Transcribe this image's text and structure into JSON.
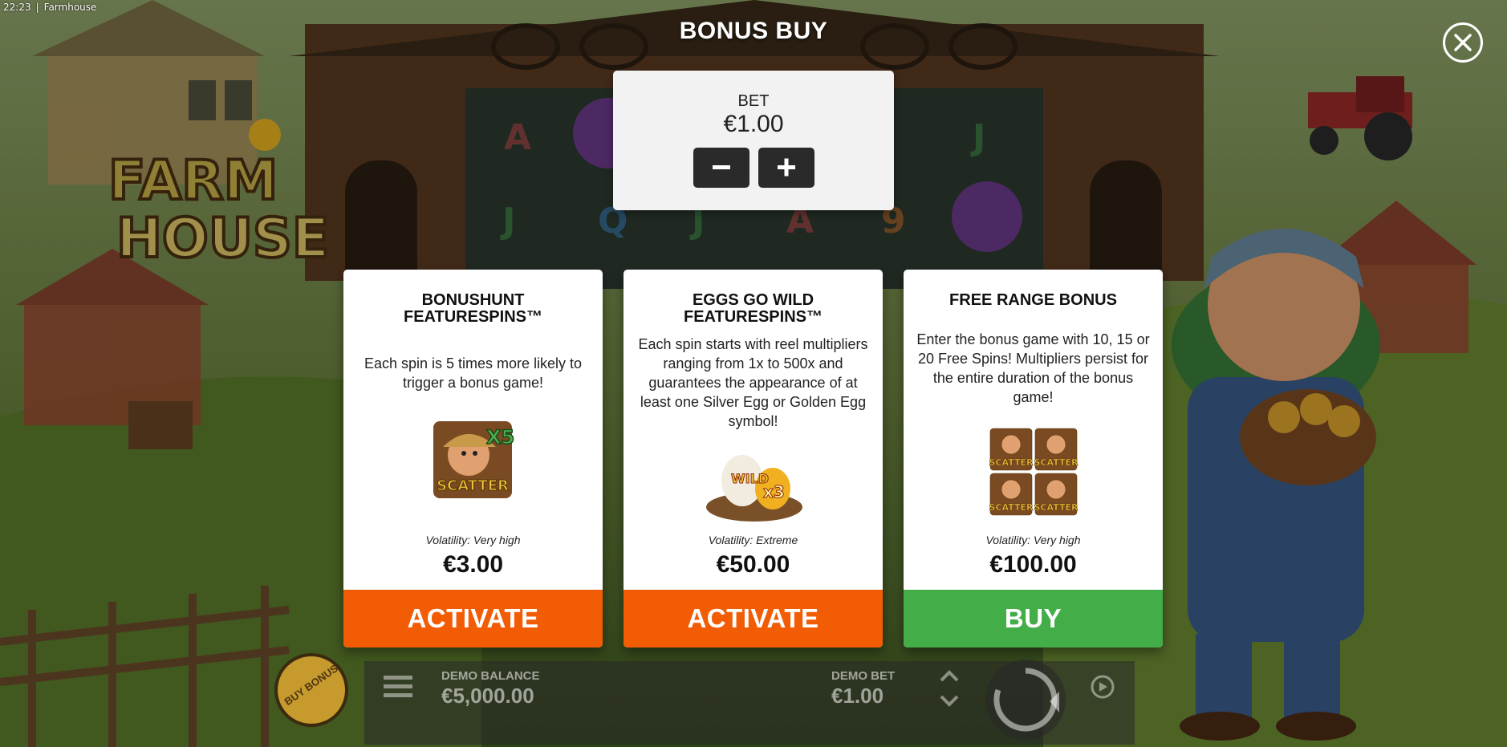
{
  "status_bar": {
    "time": "22:23",
    "separator": "|",
    "app_name": "Farmhouse"
  },
  "dialog": {
    "title": "BONUS BUY",
    "bet_label": "BET",
    "bet_value": "€1.00"
  },
  "cards": [
    {
      "title_line1": "BONUSHUNT",
      "title_line2": "FEATURESPINS™",
      "description": "Each spin is 5 times more likely to trigger a bonus game!",
      "volatility": "Volatility: Very high",
      "price": "€3.00",
      "action_label": "ACTIVATE",
      "action_color": "#f25c05"
    },
    {
      "title_line1": "EGGS GO WILD",
      "title_line2": "FEATURESPINS™",
      "description": "Each spin starts with reel multipliers ranging from 1x to 500x and guarantees the appearance of at least one Silver Egg or Golden Egg symbol!",
      "volatility": "Volatility: Extreme",
      "price": "€50.00",
      "action_label": "ACTIVATE",
      "action_color": "#f25c05"
    },
    {
      "title_line1": "FREE RANGE BONUS",
      "title_line2": "",
      "description": "Enter the bonus game with 10, 15 or 20 Free Spins! Multipliers persist for the entire duration of the bonus game!",
      "volatility": "Volatility: Very high",
      "price": "€100.00",
      "action_label": "BUY",
      "action_color": "#43ad48"
    }
  ],
  "icon_text": {
    "scatter": "SCATTER",
    "x5": "X5",
    "wild": "WILD",
    "x3": "x3"
  },
  "hud": {
    "buy_bonus_label": "BUY BONUS",
    "balance_label": "DEMO BALANCE",
    "balance_value": "€5,000.00",
    "bet_label": "DEMO BET",
    "bet_value": "€1.00"
  },
  "logo": {
    "line1": "FARM",
    "line2": "HOUSE"
  },
  "reel_letters": [
    "A",
    "J",
    "J",
    "Q",
    "J",
    "A",
    "9"
  ],
  "colors": {
    "activate": "#f25c05",
    "buy": "#43ad48"
  }
}
